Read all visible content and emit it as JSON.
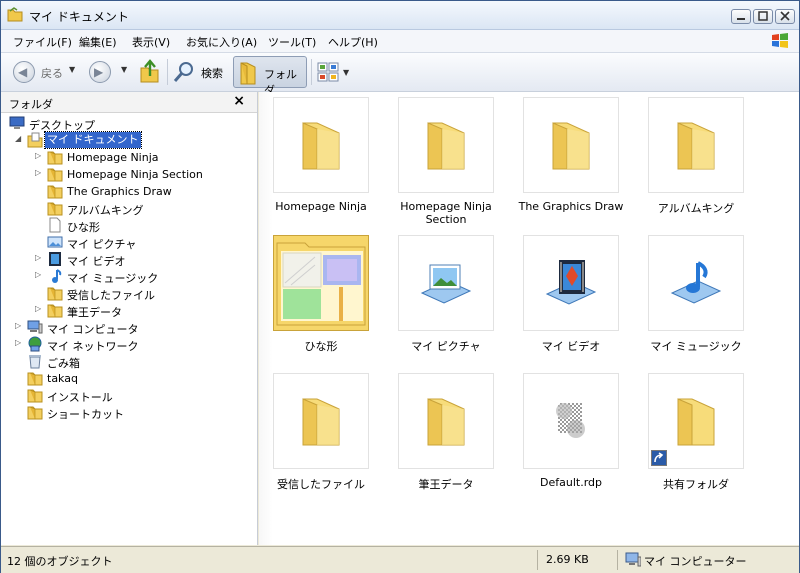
{
  "window": {
    "title": "マイ ドキュメント",
    "title_icon": "folder-icon"
  },
  "menu": [
    "ファイル(F)",
    "編集(E)",
    "表示(V)",
    "お気に入り(A)",
    "ツール(T)",
    "ヘルプ(H)"
  ],
  "toolbar": {
    "back_label": "戻る",
    "search_label": "検索",
    "folders_label": "フォルダ"
  },
  "folder_pane": {
    "title": "フォルダ",
    "close_glyph": "×",
    "items": [
      {
        "label": "デスクトップ",
        "icon": "desktop-icon"
      },
      {
        "label": "マイ ドキュメント",
        "icon": "my-documents-icon"
      },
      {
        "label": "Homepage Ninja",
        "icon": "folder-icon"
      },
      {
        "label": "Homepage Ninja Section",
        "icon": "folder-icon"
      },
      {
        "label": "The Graphics Draw",
        "icon": "folder-icon"
      },
      {
        "label": "アルバムキング",
        "icon": "folder-icon"
      },
      {
        "label": "ひな形",
        "icon": "document-icon"
      },
      {
        "label": "マイ ピクチャ",
        "icon": "pictures-icon"
      },
      {
        "label": "マイ ビデオ",
        "icon": "video-icon"
      },
      {
        "label": "マイ ミュージック",
        "icon": "music-icon"
      },
      {
        "label": "受信したファイル",
        "icon": "folder-icon"
      },
      {
        "label": "筆王データ",
        "icon": "folder-icon"
      },
      {
        "label": "マイ コンピュータ",
        "icon": "computer-icon"
      },
      {
        "label": "マイ ネットワーク",
        "icon": "network-icon"
      },
      {
        "label": "ごみ箱",
        "icon": "recycle-bin-icon"
      },
      {
        "label": "takaq",
        "icon": "folder-icon"
      },
      {
        "label": "インストール",
        "icon": "folder-icon"
      },
      {
        "label": "ショートカット",
        "icon": "folder-icon"
      }
    ]
  },
  "files": [
    {
      "label": "Homepage Ninja",
      "icon": "folder-icon"
    },
    {
      "label": "Homepage Ninja Section",
      "icon": "folder-icon"
    },
    {
      "label": "The Graphics Draw",
      "icon": "folder-icon"
    },
    {
      "label": "アルバムキング",
      "icon": "folder-icon"
    },
    {
      "label": "ひな形",
      "icon": "folder-thumbnail-icon"
    },
    {
      "label": "マイ ピクチャ",
      "icon": "pictures-icon"
    },
    {
      "label": "マイ ビデオ",
      "icon": "video-icon"
    },
    {
      "label": "マイ ミュージック",
      "icon": "music-icon"
    },
    {
      "label": "受信したファイル",
      "icon": "folder-icon"
    },
    {
      "label": "筆王データ",
      "icon": "folder-icon"
    },
    {
      "label": "Default.rdp",
      "icon": "rdp-file-icon"
    },
    {
      "label": "共有フォルダ",
      "icon": "shortcut-folder-icon"
    }
  ],
  "status": {
    "objects": "12 個のオブジェクト",
    "size": "2.69 KB",
    "location": "マイ コンピューター"
  },
  "colors": {
    "selection": "#3366cc",
    "folder": "#f5d56a",
    "title_bar": "#dbe6f4"
  }
}
